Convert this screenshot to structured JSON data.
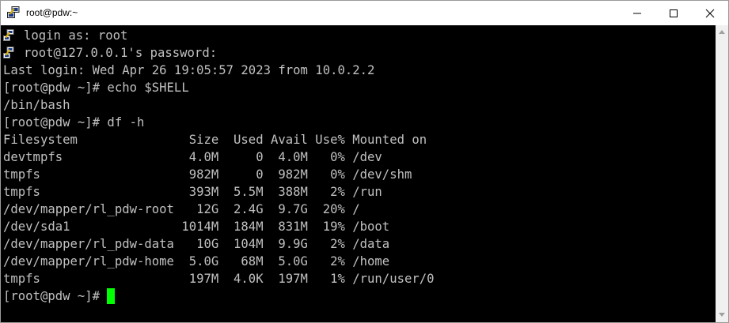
{
  "window": {
    "title": "root@pdw:~"
  },
  "terminal": {
    "lines": [
      "login as: root",
      "root@127.0.0.1's password:",
      "Last login: Wed Apr 26 19:05:57 2023 from 10.0.2.2",
      "[root@pdw ~]# echo $SHELL",
      "/bin/bash",
      "[root@pdw ~]# df -h",
      "Filesystem               Size  Used Avail Use% Mounted on",
      "devtmpfs                 4.0M     0  4.0M   0% /dev",
      "tmpfs                    982M     0  982M   0% /dev/shm",
      "tmpfs                    393M  5.5M  388M   2% /run",
      "/dev/mapper/rl_pdw-root   12G  2.4G  9.7G  20% /",
      "/dev/sda1               1014M  184M  831M  19% /boot",
      "/dev/mapper/rl_pdw-data   10G  104M  9.9G   2% /data",
      "/dev/mapper/rl_pdw-home  5.0G   68M  5.0G   2% /home",
      "tmpfs                    197M  4.0K  197M   1% /run/user/0"
    ],
    "prompt": "[root@pdw ~]#"
  },
  "colors": {
    "text": "#c0c0c0",
    "background": "#000000",
    "cursor": "#00ff00"
  },
  "icons": {
    "app": "putty-icon",
    "minimize": "minimize-icon",
    "maximize": "maximize-icon",
    "close": "close-icon"
  }
}
